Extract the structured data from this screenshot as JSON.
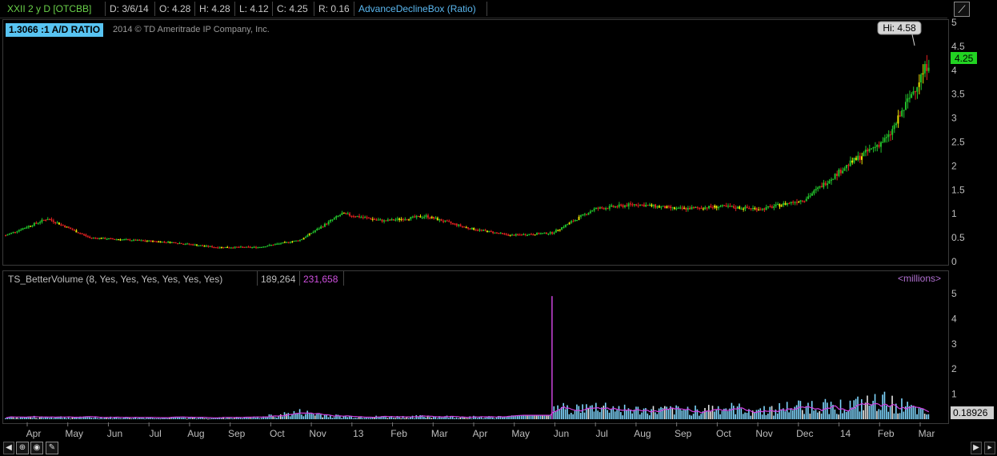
{
  "header": {
    "symbol": "XXII 2 y D [OTCBB]",
    "date": "D: 3/6/14",
    "open": "O: 4.28",
    "high": "H: 4.28",
    "low": "L: 4.12",
    "close": "C: 4.25",
    "range": "R: 0.16",
    "study": "AdvanceDeclineBox (Ratio)",
    "corner_button": "⟋"
  },
  "price_panel": {
    "ad_ratio_label": "1.3066 :1  A/D RATIO",
    "copyright": "2014 © TD Ameritrade IP Company, Inc.",
    "hi_bubble": "Hi: 4.58",
    "last_price": "4.25",
    "y_ticks": [
      "5",
      "4.5",
      "4",
      "3.5",
      "3",
      "2.5",
      "2",
      "1.5",
      "1",
      "0.5",
      "0"
    ]
  },
  "volume_panel": {
    "study_label": "TS_BetterVolume (8, Yes, Yes, Yes, Yes, Yes, Yes)",
    "value1": "189,264",
    "value2": "231,658",
    "units": "<millions>",
    "last_value": "0.18926",
    "y_ticks": [
      "5",
      "4",
      "3",
      "2",
      "1"
    ]
  },
  "x_axis": {
    "months": [
      "Apr",
      "May",
      "Jun",
      "Jul",
      "Aug",
      "Sep",
      "Oct",
      "Nov",
      "13",
      "Feb",
      "Mar",
      "Apr",
      "May",
      "Jun",
      "Jul",
      "Aug",
      "Sep",
      "Oct",
      "Nov",
      "Dec",
      "14",
      "Feb",
      "Mar"
    ]
  },
  "chart_data": [
    {
      "type": "line",
      "title": "XXII 2 y D [OTCBB]",
      "x": [
        "Apr",
        "May",
        "Jun",
        "Jul",
        "Aug",
        "Sep",
        "Oct",
        "Nov",
        "13",
        "Feb",
        "Mar",
        "Apr",
        "May",
        "Jun",
        "Jul",
        "Aug",
        "Sep",
        "Oct",
        "Nov",
        "Dec",
        "14",
        "Feb",
        "Mar"
      ],
      "series": [
        {
          "name": "",
          "values": [
            0.55,
            0.9,
            0.5,
            0.45,
            0.4,
            0.3,
            0.3,
            0.45,
            1.0,
            0.85,
            0.95,
            0.7,
            0.55,
            0.6,
            1.1,
            1.2,
            1.1,
            1.15,
            1.1,
            1.3,
            2.0,
            2.6,
            4.25
          ]
        }
      ],
      "ylim": [
        0,
        5
      ],
      "annotations": [
        "Hi: 4.58",
        "4.25"
      ],
      "colors": {
        "up": "#22c22b",
        "down": "#e02020",
        "neutral": "#e8e000",
        "last": "#22d322"
      }
    },
    {
      "type": "bar",
      "title": "TS_BetterVolume (8, Yes, Yes, Yes, Yes, Yes, Yes)",
      "categories": [
        "Apr",
        "May",
        "Jun",
        "Jul",
        "Aug",
        "Sep",
        "Oct",
        "Nov",
        "13",
        "Feb",
        "Mar",
        "Apr",
        "May",
        "Jun",
        "Jul",
        "Aug",
        "Sep",
        "Oct",
        "Nov",
        "Dec",
        "14",
        "Feb",
        "Mar"
      ],
      "values": [
        0.08,
        0.1,
        0.08,
        0.07,
        0.07,
        0.06,
        0.08,
        0.3,
        0.12,
        0.1,
        0.12,
        0.1,
        0.1,
        4.9,
        0.6,
        0.4,
        0.4,
        0.5,
        0.4,
        0.6,
        0.6,
        0.8,
        0.19
      ],
      "ylim": [
        0,
        5
      ],
      "colors": {
        "bar": "#7fd7ff",
        "spike": "#c040d0",
        "average": "#d040e0"
      }
    }
  ]
}
